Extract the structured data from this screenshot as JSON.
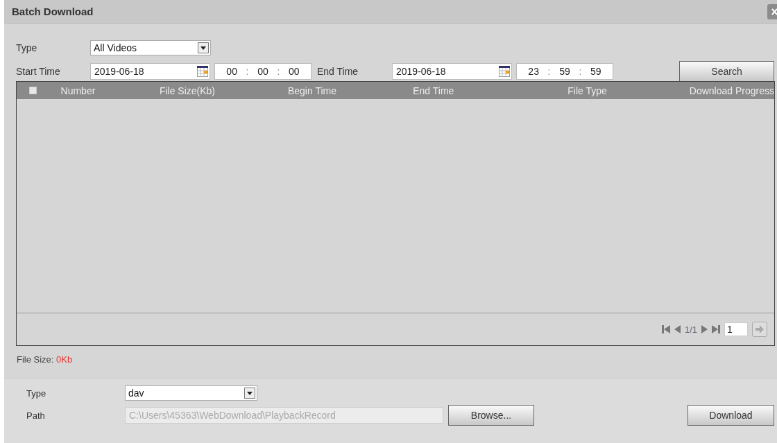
{
  "window": {
    "title": "Batch Download"
  },
  "filter": {
    "type_label": "Type",
    "type_value": "All Videos",
    "start_label": "Start Time",
    "start_date": "2019-06-18",
    "start_time": {
      "parts": [
        "00",
        "00",
        "00"
      ],
      "separator": ":"
    },
    "end_label": "End Time",
    "end_date": "2019-06-18",
    "end_time": {
      "parts": [
        "23",
        "59",
        "59"
      ],
      "separator": ":"
    },
    "search_button": "Search"
  },
  "table": {
    "select_all": {
      "checked": false
    },
    "columns": [
      "Number",
      "File Size(Kb)",
      "Begin Time",
      "End Time",
      "File Type",
      "Download Progress"
    ]
  },
  "pager": {
    "page": "1/1",
    "page_input": "1"
  },
  "file_size": {
    "label": "File Size:",
    "value": "0Kb"
  },
  "download": {
    "type_label": "Type",
    "type_value": "dav",
    "path_label": "Path",
    "path_value": "C:\\Users\\45363\\WebDownload\\PlaybackRecord",
    "path_disabled": true,
    "browse_button": "Browse...",
    "download_button": "Download"
  }
}
